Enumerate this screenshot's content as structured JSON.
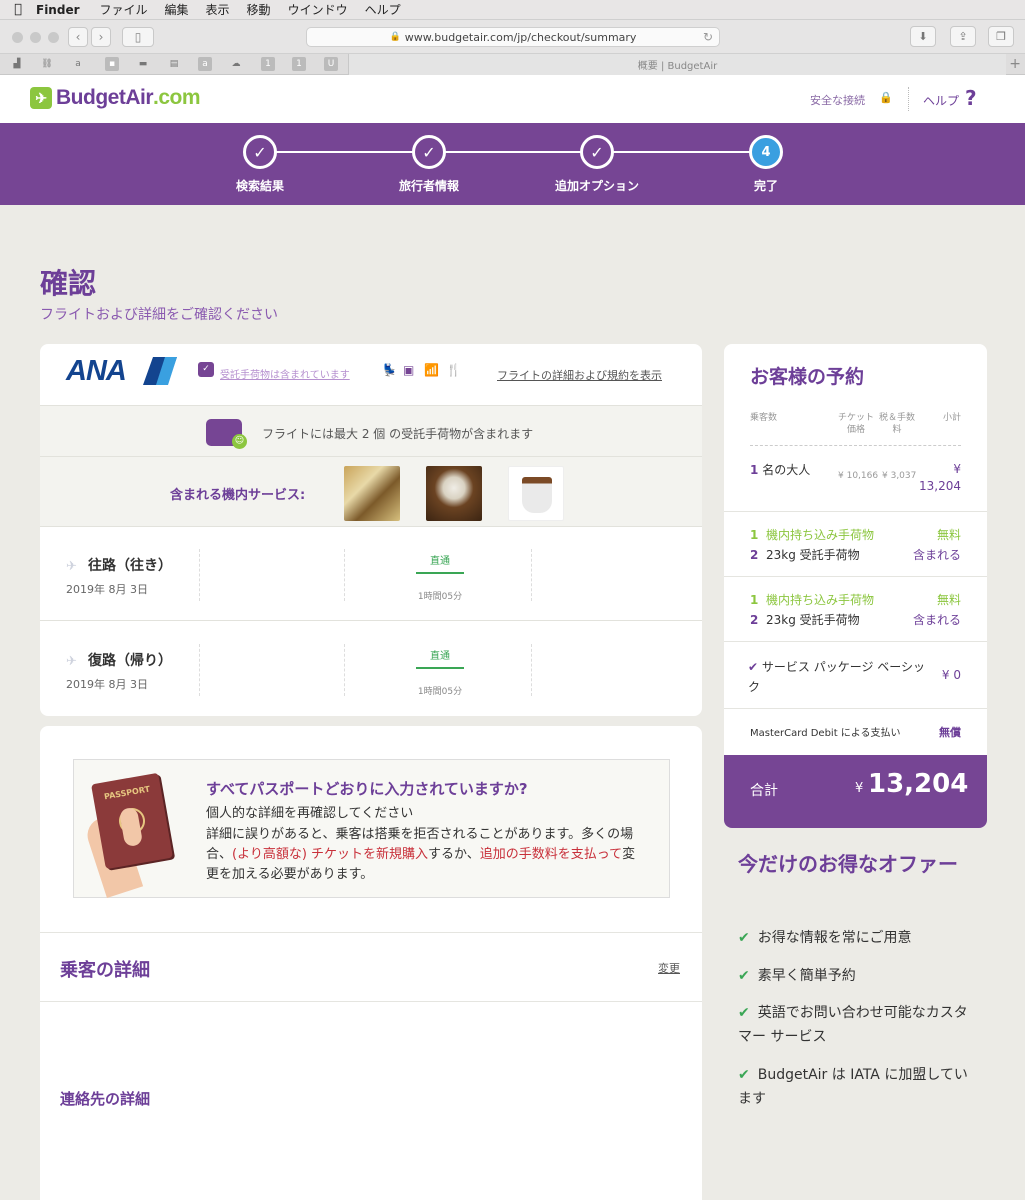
{
  "menubar": {
    "apple": "",
    "app": "Finder",
    "items": [
      "ファイル",
      "編集",
      "表示",
      "移動",
      "ウインドウ",
      "ヘルプ"
    ]
  },
  "browser": {
    "url": "www.budgetair.com/jp/checkout/summary",
    "tab_title": "概要 | BudgetAir",
    "bookmarks": [
      "a",
      "a",
      "1",
      "1",
      "U"
    ]
  },
  "header": {
    "logo_prefix": "BudgetAir",
    "logo_suffix": ".com",
    "secure": "安全な接続",
    "help": "ヘルプ",
    "help_icon": "?"
  },
  "steps": [
    {
      "label": "検索結果",
      "state": "done",
      "glyph": "✓"
    },
    {
      "label": "旅行者情報",
      "state": "done",
      "glyph": "✓"
    },
    {
      "label": "追加オプション",
      "state": "done",
      "glyph": "✓"
    },
    {
      "label": "完了",
      "state": "current",
      "glyph": "4"
    }
  ],
  "page": {
    "title": "確認",
    "subtitle": "フライトおよび詳細をご確認ください"
  },
  "flight": {
    "airline": "ANA",
    "baggage_included_link": "受託手荷物は含まれています",
    "details_link": "フライトの詳細および規約を表示",
    "baggage_banner": "フライトには最大 2 個 の受託手荷物が含まれます",
    "services_label": "含まれる機内サービス:",
    "legs": [
      {
        "title": "往路（往き）",
        "date": "2019年 8月 3日",
        "stops": "直通",
        "duration": "1時間05分"
      },
      {
        "title": "復路（帰り）",
        "date": "2019年 8月 3日",
        "stops": "直通",
        "duration": "1時間05分"
      }
    ]
  },
  "notice": {
    "passport_text": "PASSPORT",
    "title": "すべてパスポートどおりに入力されていますか?",
    "subtitle": "個人的な詳細を再確認してください",
    "body_1": "詳細に誤りがあると、乗客は搭乗を拒否されることがあります。多くの場合、",
    "body_red_1": "(より高額な) チケットを新規購入",
    "body_2": "するか、",
    "body_red_2": "追加の手数料を支払って",
    "body_3": "変更を加える必要があります。"
  },
  "passenger_details": {
    "title": "乗客の詳細",
    "change": "変更",
    "contact_title": "連絡先の詳細"
  },
  "booking": {
    "title": "お客様の予約",
    "col_passengers": "乗客数",
    "col_ticket": "チケット価格",
    "col_tax": "税＆手数料",
    "col_subtotal": "小計",
    "adult_count": "1",
    "adult_label": "名の大人",
    "ticket_price": "¥ 10,166",
    "tax": "¥ 3,037",
    "subtotal_currency": "¥",
    "subtotal": "13,204",
    "baggage_groups": [
      [
        {
          "count": "1",
          "label": "機内持ち込み手荷物",
          "value": "無料",
          "kind": "free"
        },
        {
          "count": "2",
          "label": "23kg 受託手荷物",
          "value": "含まれる",
          "kind": "inc"
        }
      ],
      [
        {
          "count": "1",
          "label": "機内持ち込み手荷物",
          "value": "無料",
          "kind": "free"
        },
        {
          "count": "2",
          "label": "23kg 受託手荷物",
          "value": "含まれる",
          "kind": "inc"
        }
      ]
    ],
    "package_label": "サービス パッケージ ベーシック",
    "package_value": "¥ 0",
    "payment_label": "MasterCard Debit による支払い",
    "payment_value": "無償",
    "total_label": "合計",
    "total_currency": "¥",
    "total_value": "13,204"
  },
  "offers": {
    "title": "今だけのお得なオファー",
    "items": [
      "お得な情報を常にご用意",
      "素早く簡単予約",
      "英語でお問い合わせ可能なカスタマー サービス",
      "BudgetAir は IATA に加盟しています"
    ]
  },
  "colors": {
    "brand_purple": "#764594",
    "brand_green": "#8cc63f",
    "current_step": "#3a9fe0"
  }
}
